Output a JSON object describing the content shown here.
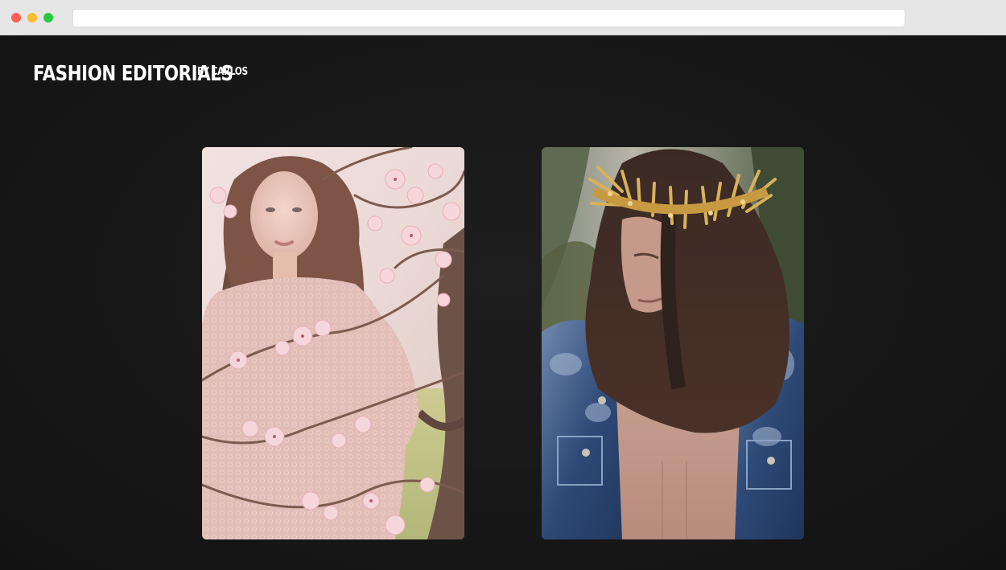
{
  "browser": {
    "window_controls": [
      "close",
      "minimize",
      "maximize"
    ],
    "address": "",
    "colors": {
      "close": "#ff5f57",
      "minimize": "#febc2e",
      "maximize": "#28c840"
    }
  },
  "site": {
    "title": "Fashion Editorials",
    "byline": "by Carlos",
    "background": "#171717",
    "text_color": "#ffffff"
  },
  "gallery": {
    "items": [
      {
        "subject": "woman among pink blossoms"
      },
      {
        "subject": "man with golden crown and denim jacket"
      }
    ]
  }
}
